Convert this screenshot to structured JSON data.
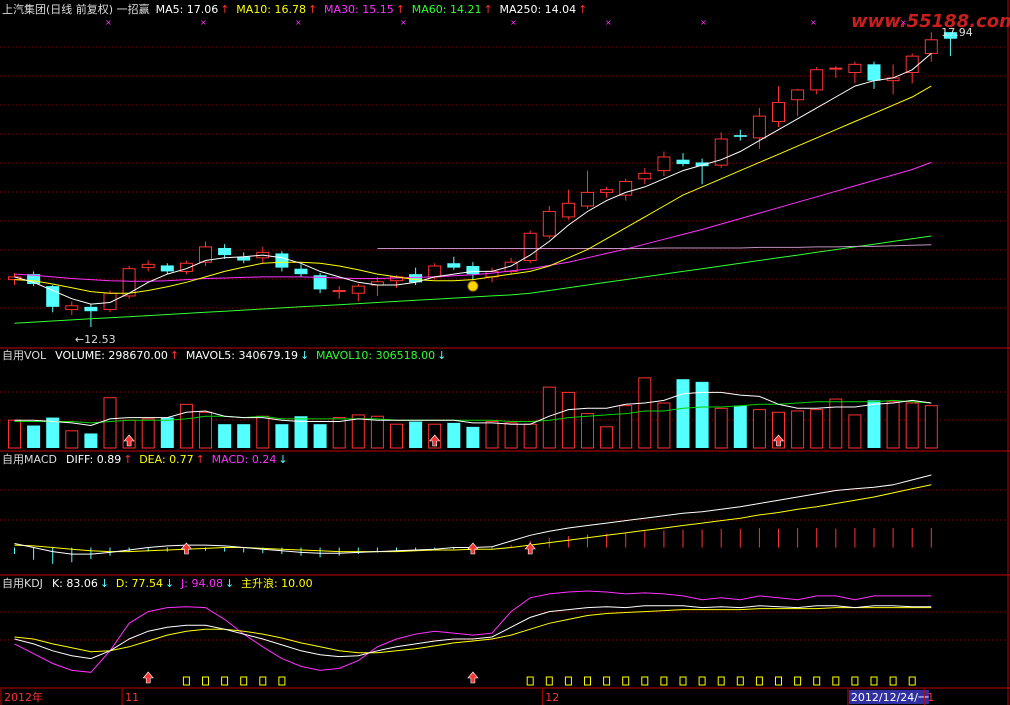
{
  "colors": {
    "up": "#ff3232",
    "down": "#54ffff",
    "grid": "#8b0000",
    "border": "#c00000",
    "white": "#ffffff",
    "yellow": "#ffff00",
    "magenta": "#ff32ff",
    "green": "#32ff32",
    "green2": "#00d200",
    "mauve": "#c090c0",
    "darkred": "#a00000",
    "text": "#dddddd"
  },
  "watermark": {
    "text": "www.55188.com"
  },
  "price_panel": {
    "title": "上汽集团(日线 前复权) 一招赢",
    "legend": [
      {
        "label": "MA5: 17.06",
        "color": "#ffffff"
      },
      {
        "label": "MA10: 16.78",
        "color": "#ffff00"
      },
      {
        "label": "MA30: 15.15",
        "color": "#ff32ff"
      },
      {
        "label": "MA60: 14.21",
        "color": "#32ff32"
      },
      {
        "label": "MA250: 14.04",
        "color": "#ffffff"
      }
    ],
    "axis_labels": {
      "high": "17.94",
      "low": "12.53"
    }
  },
  "vol_panel": {
    "legend": [
      {
        "label": "自用VOL",
        "color": "#dddddd"
      },
      {
        "label": "VOLUME: 298670.00",
        "color": "#ffffff"
      },
      {
        "label": "MAVOL5: 340679.19",
        "color": "#ffffff"
      },
      {
        "label": "MAVOL10: 306518.00",
        "color": "#32ff32"
      }
    ]
  },
  "macd_panel": {
    "legend": [
      {
        "label": "自用MACD",
        "color": "#dddddd"
      },
      {
        "label": "DIFF: 0.89",
        "color": "#ffffff"
      },
      {
        "label": "DEA: 0.77",
        "color": "#ffff00"
      },
      {
        "label": "MACD: 0.24",
        "color": "#ff32ff"
      }
    ]
  },
  "kdj_panel": {
    "legend": [
      {
        "label": "自用KDJ",
        "color": "#dddddd"
      },
      {
        "label": "K: 83.06",
        "color": "#ffffff"
      },
      {
        "label": "D: 77.54",
        "color": "#ffff00"
      },
      {
        "label": "J: 94.08",
        "color": "#ff32ff"
      },
      {
        "label": "主升浪: 10.00",
        "color": "#ffff00"
      }
    ]
  },
  "time_axis": {
    "labels": [
      {
        "text": "2012年",
        "idx": 0
      },
      {
        "text": "11",
        "idx": 6
      },
      {
        "text": "12",
        "idx": 28
      },
      {
        "text": "2012/12/24/一",
        "idx": 44,
        "highlight": true
      },
      {
        "text": "1",
        "idx": 48
      }
    ]
  },
  "chart_data": {
    "type": "candlestick",
    "title": "上汽集团(日线 前复权)",
    "series_count": 49,
    "price_range": [
      12.2,
      18.2
    ],
    "candles": [
      [
        13.4,
        13.52,
        13.3,
        13.45
      ],
      [
        13.5,
        13.55,
        13.28,
        13.32
      ],
      [
        13.28,
        13.3,
        12.8,
        12.9
      ],
      [
        12.85,
        13.0,
        12.75,
        12.92
      ],
      [
        12.9,
        12.95,
        12.53,
        12.82
      ],
      [
        12.85,
        13.2,
        12.8,
        13.15
      ],
      [
        13.1,
        13.65,
        13.05,
        13.6
      ],
      [
        13.62,
        13.75,
        13.55,
        13.68
      ],
      [
        13.66,
        13.7,
        13.5,
        13.55
      ],
      [
        13.55,
        13.75,
        13.5,
        13.7
      ],
      [
        13.72,
        14.1,
        13.65,
        14.0
      ],
      [
        13.98,
        14.05,
        13.78,
        13.85
      ],
      [
        13.82,
        13.9,
        13.7,
        13.75
      ],
      [
        13.8,
        14.0,
        13.7,
        13.9
      ],
      [
        13.88,
        13.92,
        13.55,
        13.62
      ],
      [
        13.6,
        13.68,
        13.45,
        13.5
      ],
      [
        13.48,
        13.52,
        13.15,
        13.22
      ],
      [
        13.18,
        13.28,
        13.05,
        13.2
      ],
      [
        13.15,
        13.32,
        13.0,
        13.28
      ],
      [
        13.3,
        13.45,
        13.1,
        13.36
      ],
      [
        13.38,
        13.48,
        13.25,
        13.45
      ],
      [
        13.5,
        13.62,
        13.3,
        13.35
      ],
      [
        13.45,
        13.7,
        13.4,
        13.65
      ],
      [
        13.7,
        13.82,
        13.58,
        13.62
      ],
      [
        13.65,
        13.72,
        13.4,
        13.5
      ],
      [
        13.45,
        13.62,
        13.35,
        13.55
      ],
      [
        13.55,
        13.8,
        13.5,
        13.72
      ],
      [
        13.75,
        14.3,
        13.7,
        14.25
      ],
      [
        14.2,
        14.75,
        14.15,
        14.65
      ],
      [
        14.55,
        15.05,
        14.5,
        14.8
      ],
      [
        14.75,
        15.4,
        14.7,
        15.0
      ],
      [
        15.0,
        15.1,
        14.9,
        15.05
      ],
      [
        14.95,
        15.25,
        14.85,
        15.2
      ],
      [
        15.25,
        15.45,
        15.15,
        15.35
      ],
      [
        15.4,
        15.75,
        15.3,
        15.65
      ],
      [
        15.6,
        15.72,
        15.48,
        15.52
      ],
      [
        15.55,
        15.62,
        15.15,
        15.48
      ],
      [
        15.5,
        16.1,
        15.45,
        15.98
      ],
      [
        16.05,
        16.15,
        15.95,
        16.02
      ],
      [
        16.0,
        16.55,
        15.8,
        16.4
      ],
      [
        16.3,
        16.95,
        16.2,
        16.65
      ],
      [
        16.7,
        16.9,
        16.4,
        16.88
      ],
      [
        16.88,
        17.3,
        16.8,
        17.25
      ],
      [
        17.28,
        17.32,
        17.1,
        17.28
      ],
      [
        17.2,
        17.4,
        17.0,
        17.35
      ],
      [
        17.35,
        17.4,
        16.9,
        17.05
      ],
      [
        17.05,
        17.35,
        16.8,
        17.1
      ],
      [
        17.2,
        17.55,
        17.0,
        17.5
      ],
      [
        17.55,
        17.94,
        17.4,
        17.8
      ],
      [
        17.94,
        17.94,
        17.5,
        17.82
      ]
    ],
    "volume": [
      21,
      17,
      23,
      13,
      11,
      38,
      21,
      22,
      23,
      33,
      27,
      18,
      18,
      24,
      18,
      24,
      18,
      23,
      25,
      24,
      18,
      20,
      18,
      19,
      16,
      20,
      19,
      18,
      46,
      42,
      26,
      16,
      32,
      53,
      34,
      52,
      50,
      30,
      32,
      29,
      27,
      28,
      29,
      37,
      25,
      36,
      35,
      34,
      32
    ],
    "volume_range": [
      0,
      65
    ],
    "macd": [
      -0.08,
      -0.15,
      -0.2,
      -0.18,
      -0.14,
      -0.1,
      -0.05,
      -0.05,
      -0.05,
      -0.04,
      -0.04,
      -0.05,
      -0.06,
      -0.07,
      -0.08,
      -0.1,
      -0.12,
      -0.1,
      -0.08,
      -0.06,
      -0.05,
      -0.04,
      -0.03,
      -0.02,
      -0.02,
      -0.01,
      0.03,
      0.08,
      0.12,
      0.14,
      0.16,
      0.17,
      0.18,
      0.2,
      0.21,
      0.22,
      0.22,
      0.23,
      0.23,
      0.24,
      0.23,
      0.24,
      0.24,
      0.23,
      0.24,
      0.24,
      0.24,
      0.24,
      0.24
    ],
    "diff": [
      0.05,
      0.0,
      -0.05,
      -0.08,
      -0.08,
      -0.06,
      -0.03,
      0.0,
      0.02,
      0.03,
      0.03,
      0.02,
      0.0,
      -0.02,
      -0.04,
      -0.06,
      -0.07,
      -0.07,
      -0.06,
      -0.05,
      -0.04,
      -0.03,
      -0.02,
      0.0,
      0.0,
      0.01,
      0.08,
      0.15,
      0.2,
      0.24,
      0.27,
      0.3,
      0.33,
      0.36,
      0.39,
      0.42,
      0.44,
      0.47,
      0.5,
      0.54,
      0.58,
      0.62,
      0.66,
      0.7,
      0.72,
      0.74,
      0.77,
      0.83,
      0.89
    ],
    "dea": [
      0.03,
      0.02,
      0.0,
      -0.02,
      -0.04,
      -0.05,
      -0.05,
      -0.04,
      -0.03,
      -0.02,
      -0.01,
      0.0,
      0.0,
      -0.01,
      -0.02,
      -0.03,
      -0.04,
      -0.05,
      -0.05,
      -0.05,
      -0.05,
      -0.04,
      -0.03,
      -0.03,
      -0.02,
      -0.02,
      0.0,
      0.03,
      0.06,
      0.09,
      0.12,
      0.15,
      0.18,
      0.21,
      0.24,
      0.27,
      0.3,
      0.33,
      0.36,
      0.4,
      0.43,
      0.47,
      0.5,
      0.54,
      0.58,
      0.62,
      0.67,
      0.72,
      0.77
    ],
    "macd_range": [
      -0.3,
      1.0
    ],
    "k": [
      50,
      45,
      38,
      33,
      30,
      38,
      50,
      58,
      62,
      64,
      64,
      60,
      55,
      50,
      44,
      38,
      34,
      32,
      33,
      38,
      42,
      45,
      48,
      50,
      50,
      52,
      62,
      72,
      78,
      80,
      82,
      83,
      82,
      84,
      84,
      84,
      82,
      83,
      82,
      84,
      83,
      82,
      84,
      84,
      82,
      84,
      84,
      83,
      83
    ],
    "d": [
      52,
      50,
      45,
      41,
      37,
      38,
      42,
      48,
      54,
      58,
      60,
      60,
      58,
      55,
      51,
      46,
      42,
      38,
      36,
      36,
      38,
      40,
      43,
      46,
      48,
      50,
      54,
      60,
      66,
      70,
      74,
      76,
      77,
      78,
      79,
      80,
      80,
      80,
      80,
      81,
      81,
      81,
      81,
      82,
      82,
      82,
      82,
      82,
      82
    ],
    "j": [
      45,
      35,
      25,
      18,
      16,
      38,
      66,
      78,
      82,
      83,
      82,
      70,
      55,
      42,
      30,
      22,
      18,
      20,
      28,
      42,
      50,
      55,
      58,
      56,
      54,
      56,
      78,
      92,
      96,
      98,
      99,
      98,
      96,
      97,
      96,
      94,
      90,
      92,
      90,
      94,
      92,
      90,
      94,
      94,
      90,
      94,
      94,
      94,
      94
    ],
    "kdj_range": [
      0,
      100
    ],
    "ma5": [
      13.45,
      13.35,
      13.2,
      13.05,
      12.95,
      12.98,
      13.15,
      13.35,
      13.5,
      13.6,
      13.75,
      13.8,
      13.82,
      13.85,
      13.8,
      13.7,
      13.55,
      13.45,
      13.35,
      13.3,
      13.3,
      13.35,
      13.45,
      13.5,
      13.55,
      13.55,
      13.65,
      13.85,
      14.1,
      14.4,
      14.65,
      14.85,
      15.0,
      15.1,
      15.25,
      15.4,
      15.5,
      15.6,
      15.75,
      15.95,
      16.15,
      16.35,
      16.55,
      16.75,
      16.95,
      17.05,
      17.1,
      17.25,
      17.55
    ],
    "ma10": [
      13.4,
      13.38,
      13.32,
      13.25,
      13.18,
      13.15,
      13.15,
      13.2,
      13.27,
      13.35,
      13.45,
      13.55,
      13.63,
      13.7,
      13.72,
      13.72,
      13.7,
      13.65,
      13.58,
      13.5,
      13.45,
      13.4,
      13.38,
      13.38,
      13.4,
      13.45,
      13.5,
      13.55,
      13.65,
      13.8,
      13.95,
      14.15,
      14.35,
      14.55,
      14.75,
      14.95,
      15.1,
      15.25,
      15.4,
      15.55,
      15.7,
      15.85,
      16.0,
      16.15,
      16.3,
      16.45,
      16.6,
      16.75,
      16.95
    ],
    "ma30": [
      13.5,
      13.48,
      13.45,
      13.42,
      13.4,
      13.38,
      13.37,
      13.37,
      13.38,
      13.4,
      13.42,
      13.43,
      13.44,
      13.45,
      13.45,
      13.45,
      13.44,
      13.43,
      13.42,
      13.42,
      13.43,
      13.44,
      13.45,
      13.47,
      13.49,
      13.52,
      13.56,
      13.6,
      13.66,
      13.72,
      13.8,
      13.88,
      13.96,
      14.05,
      14.14,
      14.23,
      14.32,
      14.42,
      14.52,
      14.62,
      14.72,
      14.82,
      14.92,
      15.02,
      15.12,
      15.22,
      15.32,
      15.42,
      15.55
    ],
    "ma60": [
      12.6,
      12.62,
      12.64,
      12.66,
      12.68,
      12.7,
      12.72,
      12.74,
      12.76,
      12.78,
      12.8,
      12.82,
      12.84,
      12.86,
      12.88,
      12.9,
      12.92,
      12.94,
      12.96,
      12.98,
      13.0,
      13.02,
      13.04,
      13.06,
      13.08,
      13.1,
      13.12,
      13.15,
      13.2,
      13.25,
      13.3,
      13.35,
      13.4,
      13.45,
      13.5,
      13.55,
      13.6,
      13.65,
      13.7,
      13.75,
      13.8,
      13.85,
      13.9,
      13.95,
      14.0,
      14.05,
      14.1,
      14.15,
      14.2
    ],
    "ma250": [
      null,
      null,
      null,
      null,
      null,
      null,
      null,
      null,
      null,
      null,
      null,
      null,
      null,
      null,
      null,
      null,
      null,
      null,
      null,
      13.97,
      13.97,
      13.97,
      13.97,
      13.97,
      13.97,
      13.97,
      13.97,
      13.97,
      13.97,
      13.97,
      13.97,
      13.97,
      13.97,
      13.97,
      13.98,
      13.98,
      13.98,
      13.98,
      13.98,
      13.99,
      13.99,
      13.99,
      14.0,
      14.0,
      14.01,
      14.01,
      14.02,
      14.03,
      14.04
    ],
    "mavol5": [
      21,
      21,
      20,
      19,
      17,
      22,
      23,
      23,
      23,
      27,
      28,
      24,
      23,
      23,
      21,
      20,
      20,
      20,
      22,
      21,
      21,
      21,
      21,
      21,
      19,
      19,
      18,
      18,
      24,
      29,
      30,
      30,
      33,
      34,
      36,
      41,
      42,
      42,
      40,
      39,
      33,
      30,
      30,
      31,
      31,
      33,
      34,
      36,
      34
    ],
    "mavol10": [
      20,
      20,
      20,
      20,
      19,
      20,
      21,
      21,
      21,
      22,
      24,
      24,
      23,
      24,
      22,
      22,
      22,
      22,
      22,
      22,
      21,
      21,
      21,
      21,
      21,
      21,
      20,
      20,
      21,
      23,
      24,
      25,
      26,
      28,
      28,
      30,
      31,
      31,
      32,
      33,
      33,
      34,
      35,
      35,
      35,
      35,
      36,
      35,
      34
    ],
    "arrows_vol": [
      6,
      22,
      40
    ],
    "arrows_macd": [
      9,
      24,
      27
    ],
    "arrows_kdj": [
      7,
      24
    ],
    "kdj_boxes": [
      9,
      10,
      11,
      12,
      13,
      14,
      27,
      28,
      29,
      30,
      31,
      32,
      33,
      34,
      35,
      36,
      37,
      38,
      39,
      40,
      41,
      42,
      43,
      44,
      45,
      46,
      47
    ]
  }
}
